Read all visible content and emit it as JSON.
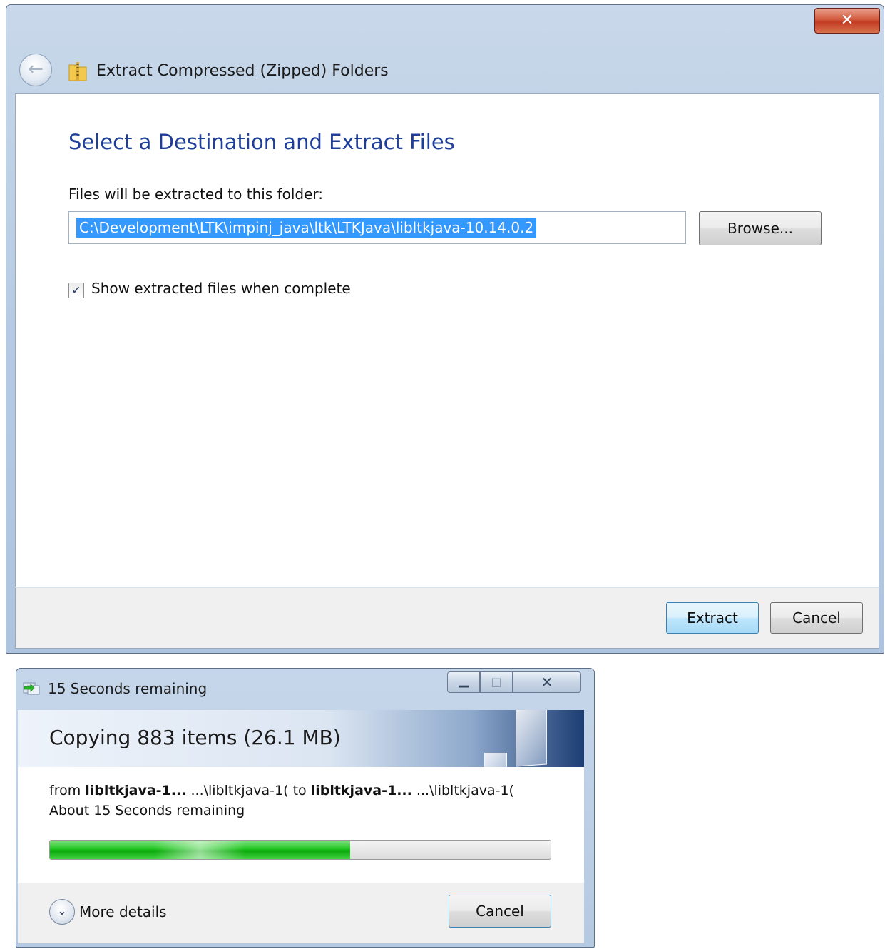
{
  "extract_dialog": {
    "title": "Extract Compressed (Zipped) Folders",
    "heading": "Select a Destination and Extract Files",
    "folder_label": "Files will be extracted to this folder:",
    "folder_path": "C:\\Development\\LTK\\impinj_java\\ltk\\LTKJava\\libltkjava-10.14.0.2",
    "browse_label": "Browse...",
    "show_files_label": "Show extracted files when complete",
    "show_files_checked": true,
    "extract_label": "Extract",
    "cancel_label": "Cancel",
    "close_glyph": "✕",
    "icons": {
      "back": "back-arrow-icon",
      "folder": "zip-folder-icon"
    }
  },
  "copy_dialog": {
    "title": "15 Seconds remaining",
    "heading": "Copying 883 items (26.1 MB)",
    "from_prefix": "from",
    "from_name": "libltkjava-1...",
    "from_path": "...\\libltkjava-1(",
    "to_prefix": "to",
    "to_name": "libltkjava-1...",
    "to_path": "...\\libltkjava-1(",
    "time_remaining": "About 15 Seconds remaining",
    "progress_fraction": 0.6,
    "more_details_label": "More details",
    "cancel_label": "Cancel",
    "close_glyph": "✕",
    "minimize_glyph": "▁",
    "maximize_glyph": "□",
    "icons": {
      "title": "copy-progress-icon",
      "expand": "chevron-down-icon"
    }
  },
  "colors": {
    "heading_blue": "#1e3e9a",
    "selection_blue": "#3399ff",
    "progress_green": "#22c722",
    "close_red": "#c23b22"
  }
}
